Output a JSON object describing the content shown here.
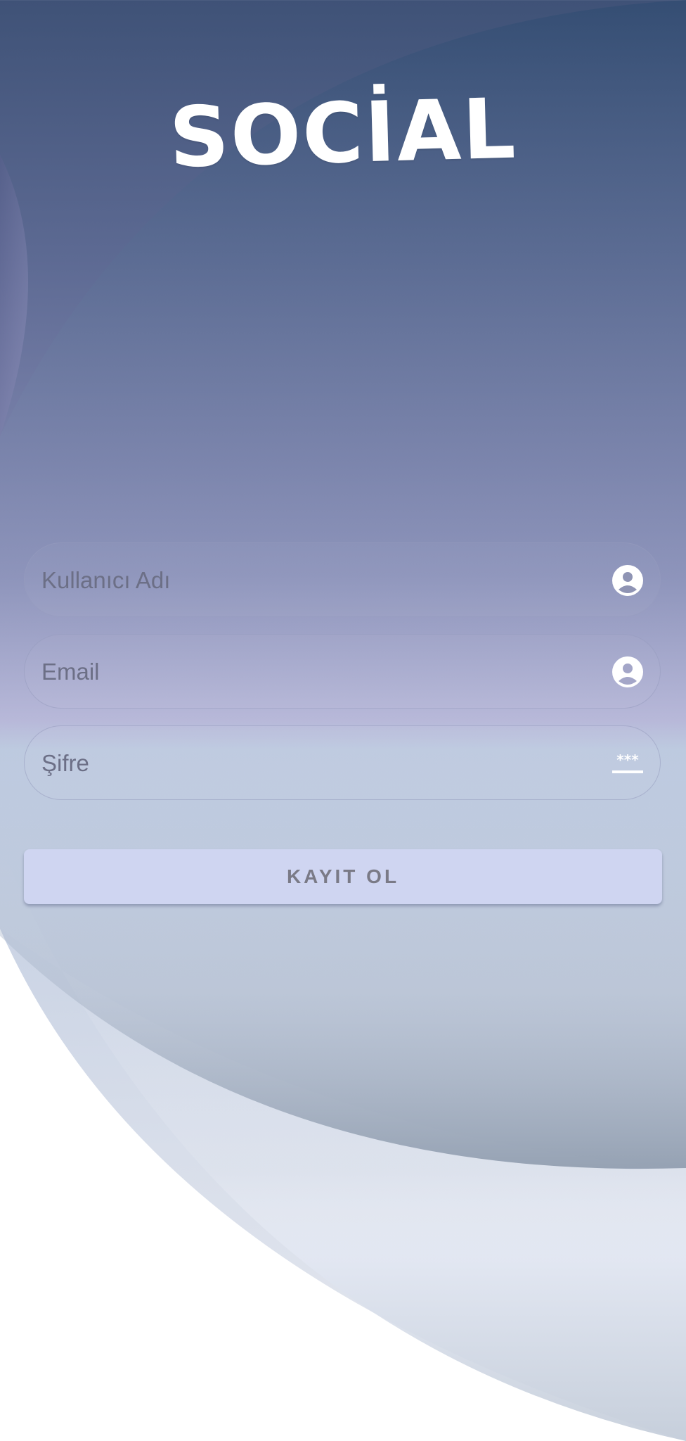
{
  "app": {
    "logo_text": "SOCİAL"
  },
  "form": {
    "username": {
      "placeholder": "Kullanıcı Adı",
      "value": "",
      "icon": "account-circle-icon"
    },
    "email": {
      "placeholder": "Email",
      "value": "",
      "icon": "account-circle-icon"
    },
    "password": {
      "placeholder": "Şifre",
      "value": "",
      "icon": "password-icon"
    },
    "submit_label": "KAYIT OL"
  },
  "colors": {
    "background_top": "#3f5277",
    "background_mid": "#b8b6d8",
    "button_bg": "#cfd5f1",
    "button_text": "#7a7a86",
    "logo": "#ffffff"
  }
}
